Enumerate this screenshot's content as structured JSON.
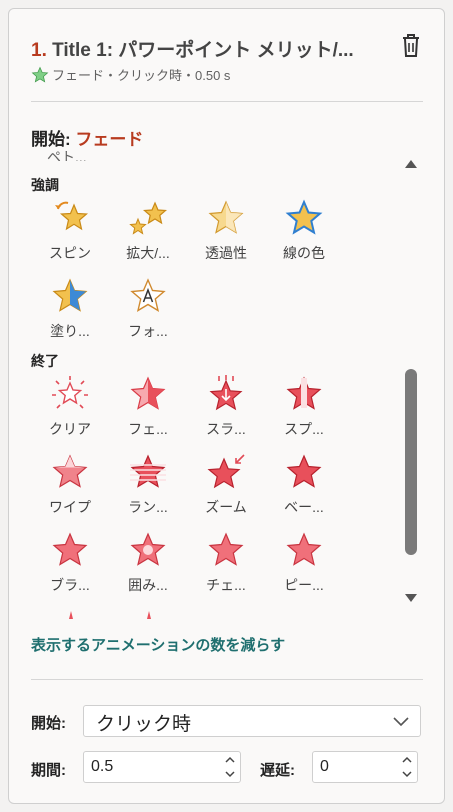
{
  "header": {
    "number": "1.",
    "title": "Title 1: パワーポイント メリット/...",
    "subtitle": "フェード・クリック時・0.50 s"
  },
  "start_label": "開始:",
  "start_value": "フェード",
  "truncated_top_label": "ペト...",
  "sections": {
    "emphasis": "強調",
    "exit": "終了"
  },
  "emphasis_effects": [
    {
      "label": "スピン",
      "icon": "spin-star-icon"
    },
    {
      "label": "拡大/...",
      "icon": "grow-star-icon"
    },
    {
      "label": "透過性",
      "icon": "transparency-star-icon"
    },
    {
      "label": "線の色",
      "icon": "line-color-star-icon"
    },
    {
      "label": "塗り...",
      "icon": "fill-color-star-icon"
    },
    {
      "label": "フォ...",
      "icon": "font-star-icon"
    }
  ],
  "exit_effects": [
    {
      "label": "クリア",
      "icon": "disappear-star-icon"
    },
    {
      "label": "フェ...",
      "icon": "fade-star-icon"
    },
    {
      "label": "スラ...",
      "icon": "fly-out-star-icon"
    },
    {
      "label": "スプ...",
      "icon": "split-star-icon"
    },
    {
      "label": "ワイプ",
      "icon": "wipe-star-icon"
    },
    {
      "label": "ラン...",
      "icon": "random-bars-star-icon"
    },
    {
      "label": "ズーム",
      "icon": "zoom-star-icon"
    },
    {
      "label": "ベー...",
      "icon": "basic-star-icon"
    },
    {
      "label": "ブラ...",
      "icon": "blinds-star-icon"
    },
    {
      "label": "囲み...",
      "icon": "circle-star-icon"
    },
    {
      "label": "チェ...",
      "icon": "checkerboard-star-icon"
    },
    {
      "label": "ピー...",
      "icon": "peek-star-icon"
    }
  ],
  "reduce_link": "表示するアニメーションの数を減らす",
  "timing": {
    "start_label": "開始:",
    "start_value": "クリック時",
    "duration_label": "期間:",
    "duration_value": "0.5",
    "delay_label": "遅延:",
    "delay_value": "0"
  },
  "colors": {
    "accent": "#b83b1f",
    "link": "#1f6f6f",
    "emphasis_star": "#f2c14e",
    "exit_star": "#e8505b"
  }
}
